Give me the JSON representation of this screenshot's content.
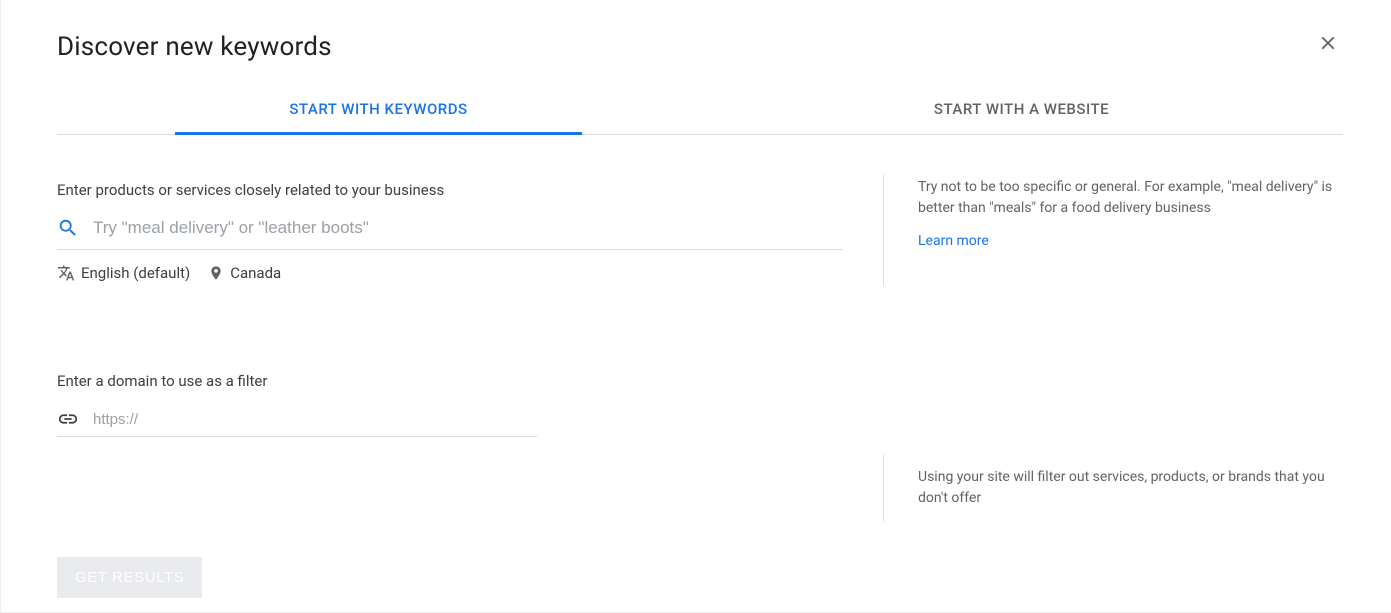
{
  "title": "Discover new keywords",
  "tabs": {
    "keywords": "START WITH KEYWORDS",
    "website": "START WITH A WEBSITE"
  },
  "products": {
    "label": "Enter products or services closely related to your business",
    "placeholder": "Try \"meal delivery\" or \"leather boots\"",
    "language": "English (default)",
    "location": "Canada"
  },
  "hint1": "Try not to be too specific or general. For example, \"meal delivery\" is better than \"meals\" for a food delivery business",
  "learn_more": "Learn more",
  "domain": {
    "label": "Enter a domain to use as a filter",
    "placeholder": "https://"
  },
  "hint2": "Using your site will filter out services, products, or brands that you don't offer",
  "get_results": "GET RESULTS"
}
